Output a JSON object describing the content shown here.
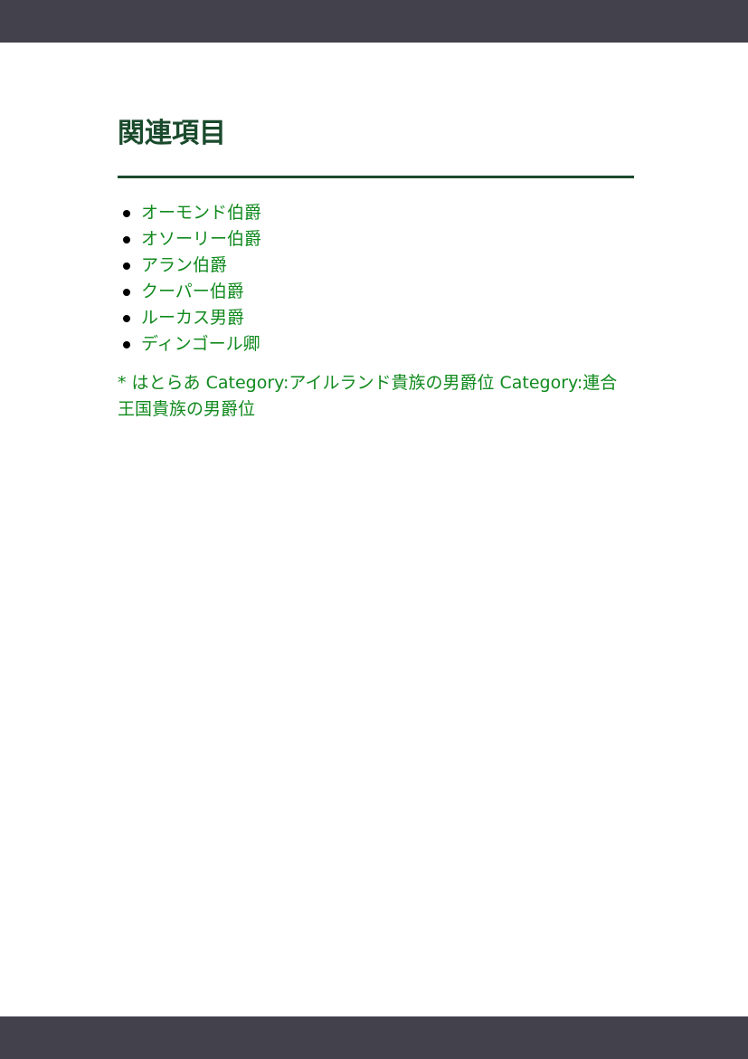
{
  "heading": "関連項目",
  "links": [
    "オーモンド伯爵",
    "オソーリー伯爵",
    "アラン伯爵",
    "クーパー伯爵",
    "ルーカス男爵",
    "ディンゴール卿"
  ],
  "footer_text": "* はとらあ Category:アイルランド貴族の男爵位 Category:連合王国貴族の男爵位",
  "colors": {
    "bar": "#43414b",
    "heading": "#1a4a2c",
    "link": "#118a1e"
  }
}
